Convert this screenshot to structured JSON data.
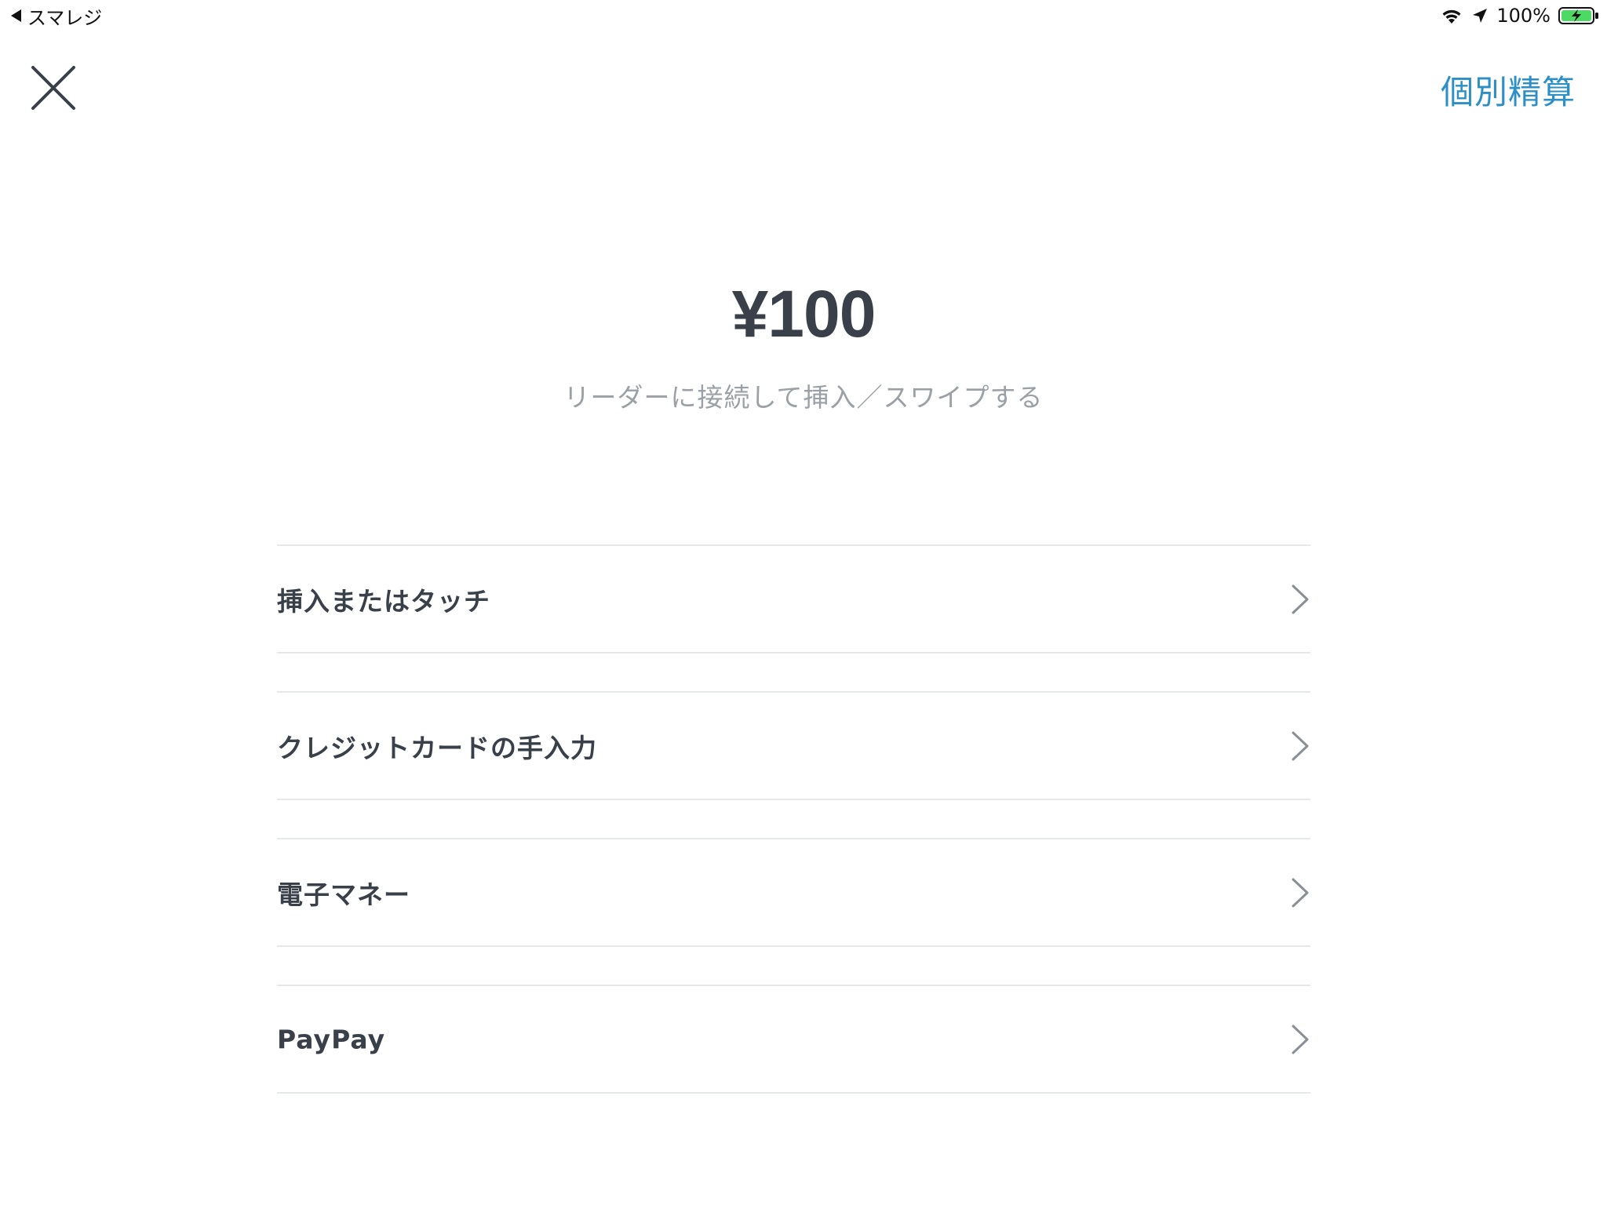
{
  "status_bar": {
    "back_app": "スマレジ",
    "battery": "100%"
  },
  "header": {
    "close_icon": "close-icon",
    "split_payment": "個別精算"
  },
  "payment": {
    "amount": "¥100",
    "instruction": "リーダーに接続して挿入／スワイプする"
  },
  "options": [
    {
      "label": "挿入またはタッチ"
    },
    {
      "label": "クレジットカードの手入力"
    },
    {
      "label": "電子マネー"
    },
    {
      "label": "PayPay"
    }
  ],
  "colors": {
    "accent": "#2c8fc6",
    "text": "#3a4049",
    "muted": "#9aa0a6",
    "divider": "#e6e8ea",
    "battery_green": "#4cd964"
  }
}
